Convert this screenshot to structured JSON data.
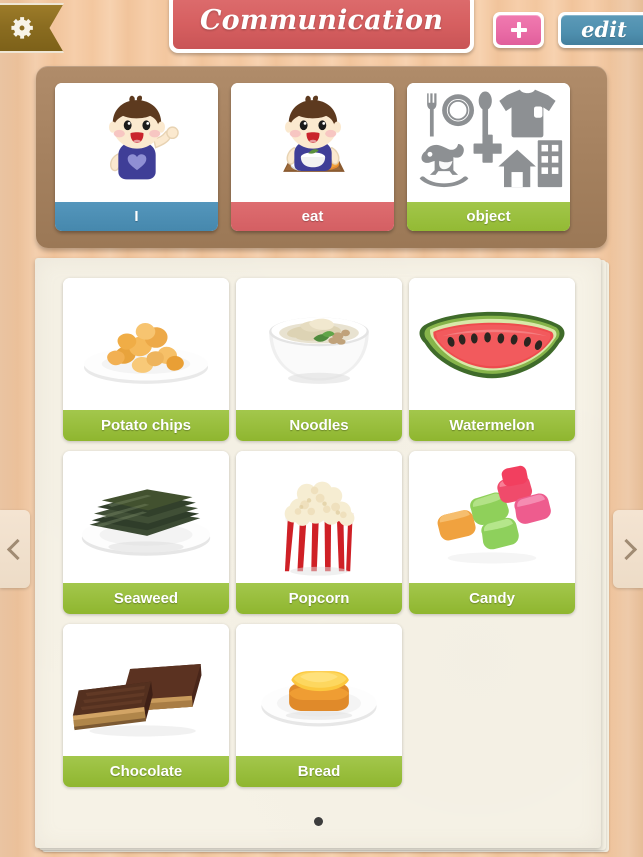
{
  "app": {
    "title": "Communication",
    "settings_icon": "gear-icon",
    "add_label": "+",
    "edit_label": "edit"
  },
  "sentence_strip": {
    "cards": [
      {
        "label": "I",
        "color": "#4a8fb5",
        "icon": "boy-waving-image",
        "slot": "subject"
      },
      {
        "label": "eat",
        "color": "#d9656a",
        "icon": "boy-eating-image",
        "slot": "verb"
      },
      {
        "label": "object",
        "color": "#9ac33e",
        "icon": "object-category-collage-icon",
        "slot": "object"
      }
    ]
  },
  "grid": {
    "items": [
      {
        "label": "Potato chips",
        "icon": "potato-chips-image"
      },
      {
        "label": "Noodles",
        "icon": "noodles-bowl-image"
      },
      {
        "label": "Watermelon",
        "icon": "watermelon-slice-image"
      },
      {
        "label": "Seaweed",
        "icon": "seaweed-plate-image"
      },
      {
        "label": "Popcorn",
        "icon": "popcorn-bucket-image"
      },
      {
        "label": "Candy",
        "icon": "candy-pieces-image"
      },
      {
        "label": "Chocolate",
        "icon": "chocolate-bars-image"
      },
      {
        "label": "Bread",
        "icon": "bread-slice-plate-image"
      }
    ],
    "label_color": "#9ac33e"
  },
  "pagination": {
    "total_pages": 1,
    "current_page": 1,
    "prev_label": "‹",
    "next_label": "›"
  },
  "colors": {
    "title_plate": "#d65f60",
    "add_button": "#e96ba5",
    "edit_button": "#4e8fae",
    "tray": "#a5815f",
    "paper": "#f6f2e6",
    "background": "#f3c79f"
  }
}
